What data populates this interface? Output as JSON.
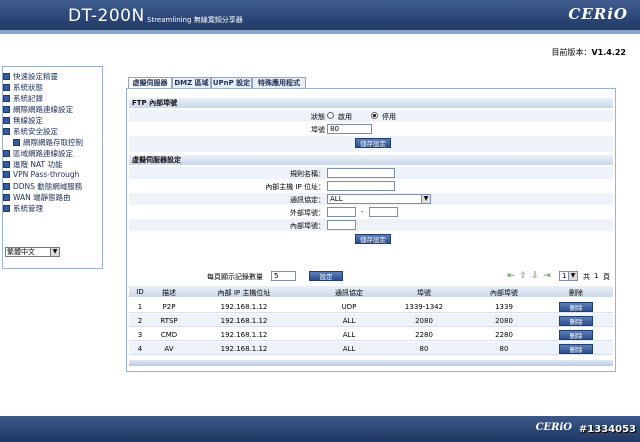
{
  "header": {
    "model": "DT-200N",
    "subtitle": "Streamlining 無線寬頻分享器",
    "logo": "CERiO"
  },
  "version": {
    "label": "目前版本：",
    "value": "V1.4.22"
  },
  "sidebar": {
    "items": [
      {
        "label": "快速設定精靈"
      },
      {
        "label": "系統狀態"
      },
      {
        "label": "系統記錄"
      },
      {
        "label": "網際網路連線設定"
      },
      {
        "label": "無線設定"
      },
      {
        "label": "系統安全設定"
      },
      {
        "label": "網際網路存取控制"
      },
      {
        "label": "區域網路連線設定"
      },
      {
        "label": "進階 NAT 功能"
      },
      {
        "label": "VPN Pass-through"
      },
      {
        "label": "DDNS 動態網域服務"
      },
      {
        "label": "WAN 端靜態路由"
      },
      {
        "label": "系統管理"
      }
    ],
    "language": "繁體中文"
  },
  "tabs": [
    {
      "label": "虛擬伺服器"
    },
    {
      "label": "DMZ 區域"
    },
    {
      "label": "UPnP 設定"
    },
    {
      "label": "特殊應用程式"
    }
  ],
  "ftp": {
    "title": "FTP 內部埠號",
    "status_label": "狀態",
    "enable": "啟用",
    "disable": "停用",
    "port_label": "埠號",
    "port_value": "80",
    "save": "儲存設定"
  },
  "vs": {
    "title": "虛擬伺服器設定",
    "rule_name_label": "規則名稱：",
    "internal_ip_label": "內部主機 IP 位址：",
    "protocol_label": "通訊協定：",
    "protocol_value": "ALL",
    "external_port_label": "外部埠號：",
    "internal_port_label": "內部埠號：",
    "dash": "-",
    "save": "儲存設定"
  },
  "paging": {
    "per_page_label": "每頁顯示記錄數量",
    "per_page_value": "5",
    "set": "設定",
    "page_value": "1",
    "total_prefix": "共",
    "total_value": "1",
    "total_suffix": "頁"
  },
  "table": {
    "headers": [
      "ID",
      "描述",
      "內部 IP 主機位址",
      "通訊協定",
      "埠號",
      "內部埠號",
      "刪除"
    ],
    "rows": [
      {
        "id": "1",
        "desc": "P2P",
        "ip": "192.168.1.12",
        "proto": "UDP",
        "port": "1339-1342",
        "iport": "1339",
        "del": "刪除"
      },
      {
        "id": "2",
        "desc": "RTSP",
        "ip": "192.168.1.12",
        "proto": "ALL",
        "port": "2080",
        "iport": "2080",
        "del": "刪除"
      },
      {
        "id": "3",
        "desc": "CMD",
        "ip": "192.168.1.12",
        "proto": "ALL",
        "port": "2280",
        "iport": "2280",
        "del": "刪除"
      },
      {
        "id": "4",
        "desc": "AV",
        "ip": "192.168.1.12",
        "proto": "ALL",
        "port": "80",
        "iport": "80",
        "del": "刪除"
      }
    ]
  },
  "footer": {
    "logo": "CERiO",
    "watermark": "#1334053"
  }
}
